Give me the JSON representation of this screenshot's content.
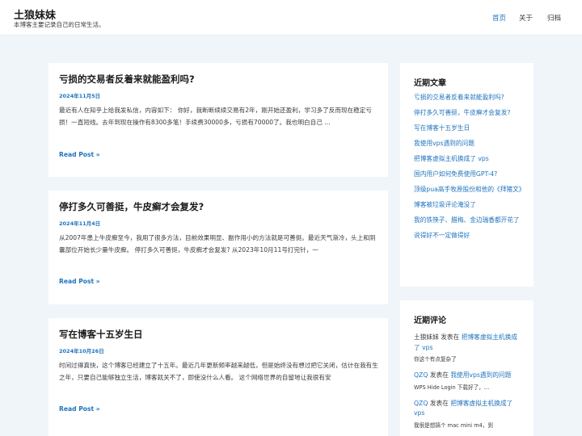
{
  "site": {
    "title": "土狼妹妹",
    "description": "本博客主要记录自己的日常生活。"
  },
  "nav": {
    "items": [
      {
        "label": "首页",
        "active": true
      },
      {
        "label": "关于",
        "active": false
      },
      {
        "label": "归档",
        "active": false
      }
    ]
  },
  "posts": [
    {
      "title": "亏损的交易者反着来就能盈利吗?",
      "date": "2024年11月5日",
      "excerpt": "最近有人在知乎上给我发私信，内容如下： 你好，我断断续续交易有2年，刚开始还盈利，学习多了反而现在稳定亏损！一直短线。去年到现在操作有8300多笔！手续费30000多，亏损有70000了。我也明白自己 …",
      "read_more": "Read Post »"
    },
    {
      "title": "停打多久可善挺，牛皮癣才会复发?",
      "date": "2024年11月4日",
      "excerpt": "从2007年患上牛皮癣至今，我用了很多方法，目前效果明显、副作用小的方法就是可善挺。最近天气渐冷，头上和阴囊部位开始长少量牛皮癣。 停打多久可善挺，牛皮癣才会复发? 从2023年10月11号打完针，一",
      "read_more": "Read Post »"
    },
    {
      "title": "写在博客十五岁生日",
      "date": "2024年10月26日",
      "excerpt": "时间过得真快，这个博客已经建立了十五年。最近几年更新频率越来越低，但是始终没有想过把它关闭，估计在我有生之年，只要自己能够独立生活，博客就关不了，即使没什么人看。 这个网络世界的自留地让我很有安",
      "read_more": "Read Post »"
    }
  ],
  "sidebar": {
    "recent_posts": {
      "title": "近期文章",
      "items": [
        "亏损的交易者反着来就能盈利吗?",
        "停打多久可善挺，牛皮癣才会复发?",
        "写在博客十五岁生日",
        "我使用vps遇到的问题",
        "把博客虚拟主机换成了 vps",
        "国内用户如何免费使用GPT-4?",
        "顶级pua高手牧原股份和他的《拜猪文》",
        "博客被垃圾评论淹没了",
        "我的铁筷子、腊梅、金边瑞香都开花了",
        "说得好不一定做得好"
      ]
    },
    "recent_comments": {
      "title": "近期评论",
      "items": [
        {
          "author": "土狼妹妹",
          "author_linked": false,
          "on": "发表在",
          "post": "把博客虚拟主机换成了 vps",
          "excerpt": "你这个有点复杂了"
        },
        {
          "author": "QZQ",
          "author_linked": true,
          "on": "发表在",
          "post": "我使用vps遇到的问题",
          "excerpt": "WPS Hide Login 下载好了，…"
        },
        {
          "author": "QZQ",
          "author_linked": true,
          "on": "发表在",
          "post": "把博客虚拟主机换成了 vps",
          "excerpt": "我很是想搞个 mac mini m4，到"
        }
      ]
    }
  }
}
